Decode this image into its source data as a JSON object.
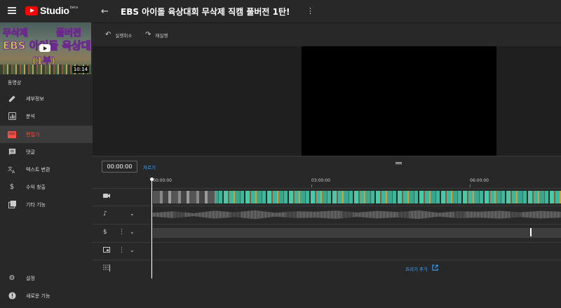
{
  "app": {
    "logo_text": "Studio",
    "logo_badge": "beta"
  },
  "header": {
    "title": "EBS 아이돌 육상대회 무삭제 직캠 풀버전 1탄!"
  },
  "thumbnail": {
    "overlay_line1_left": "무삭제",
    "overlay_line1_right": "풀버전",
    "overlay_line2": "EBS 아이돌 육상대회",
    "overlay_line3": "(1부)",
    "duration": "10:14"
  },
  "sidebar": {
    "section_label": "동영상",
    "items": [
      {
        "label": "세부정보",
        "icon": "pencil-icon"
      },
      {
        "label": "분석",
        "icon": "analytics-icon"
      },
      {
        "label": "편집기",
        "icon": "editor-icon",
        "active": true
      },
      {
        "label": "댓글",
        "icon": "comment-icon"
      },
      {
        "label": "텍스트 변환",
        "icon": "translate-icon"
      },
      {
        "label": "수익 창출",
        "icon": "dollar-icon"
      },
      {
        "label": "기타 기능",
        "icon": "more-features-icon"
      }
    ],
    "bottom": [
      {
        "label": "설정",
        "icon": "gear-icon"
      },
      {
        "label": "새로운 기능",
        "icon": "whats-new-icon"
      }
    ]
  },
  "toolbar": {
    "undo_label": "실행취소",
    "redo_label": "재실행"
  },
  "timeline": {
    "timecode": "00:00:00",
    "cut_label": "자르기",
    "ruler_labels": [
      "00:00:00",
      "03:00:00",
      "06:00:00"
    ],
    "add_blur_label": "흐리기 추가"
  },
  "colors": {
    "accent_red": "#ff4e45",
    "link_blue": "#3ea6ff",
    "video_strip": "#3fb69a"
  }
}
